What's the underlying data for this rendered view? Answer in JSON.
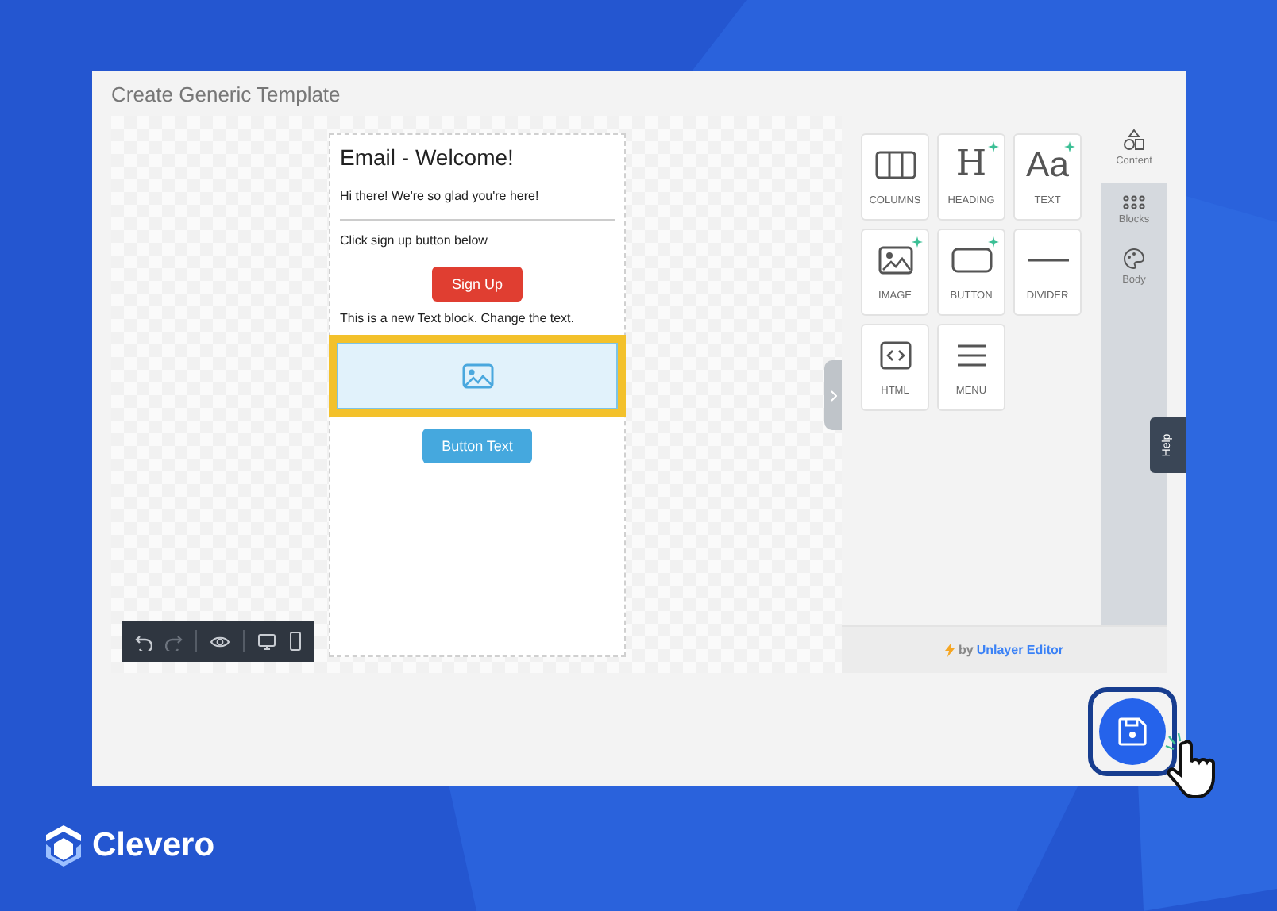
{
  "window": {
    "title": "Create Generic Template"
  },
  "email": {
    "heading": "Email - Welcome!",
    "intro": "Hi there! We're so glad you're here!",
    "prompt": "Click sign up button below",
    "primary_button": "Sign Up",
    "text_block": "This is a new Text block. Change the text.",
    "image_block": {
      "selected": true
    },
    "secondary_button": "Button Text"
  },
  "canvas_toolbar": [
    {
      "kind": "undo",
      "disabled": false
    },
    {
      "kind": "redo",
      "disabled": true
    },
    {
      "kind": "preview",
      "disabled": false
    },
    {
      "kind": "desktop",
      "disabled": false
    },
    {
      "kind": "mobile",
      "disabled": false
    }
  ],
  "tools": [
    {
      "kind": "columns",
      "label": "COLUMNS",
      "sparkle": false
    },
    {
      "kind": "heading",
      "label": "HEADING",
      "glyph": "H",
      "sparkle": true
    },
    {
      "kind": "text",
      "label": "TEXT",
      "glyph": "Aa",
      "sparkle": true
    },
    {
      "kind": "image",
      "label": "IMAGE",
      "sparkle": true
    },
    {
      "kind": "button",
      "label": "BUTTON",
      "sparkle": true
    },
    {
      "kind": "divider",
      "label": "DIVIDER",
      "sparkle": false
    },
    {
      "kind": "html",
      "label": "HTML",
      "sparkle": false
    },
    {
      "kind": "menu",
      "label": "MENU",
      "sparkle": false
    }
  ],
  "side_tabs": [
    {
      "kind": "content",
      "label": "Content",
      "selected": true
    },
    {
      "kind": "blocks",
      "label": "Blocks",
      "selected": false
    },
    {
      "kind": "body",
      "label": "Body",
      "selected": false
    }
  ],
  "footer": {
    "prefix": "by",
    "brand": "Unlayer Editor"
  },
  "help_tab": "Help",
  "logo": {
    "name": "Clevero"
  }
}
